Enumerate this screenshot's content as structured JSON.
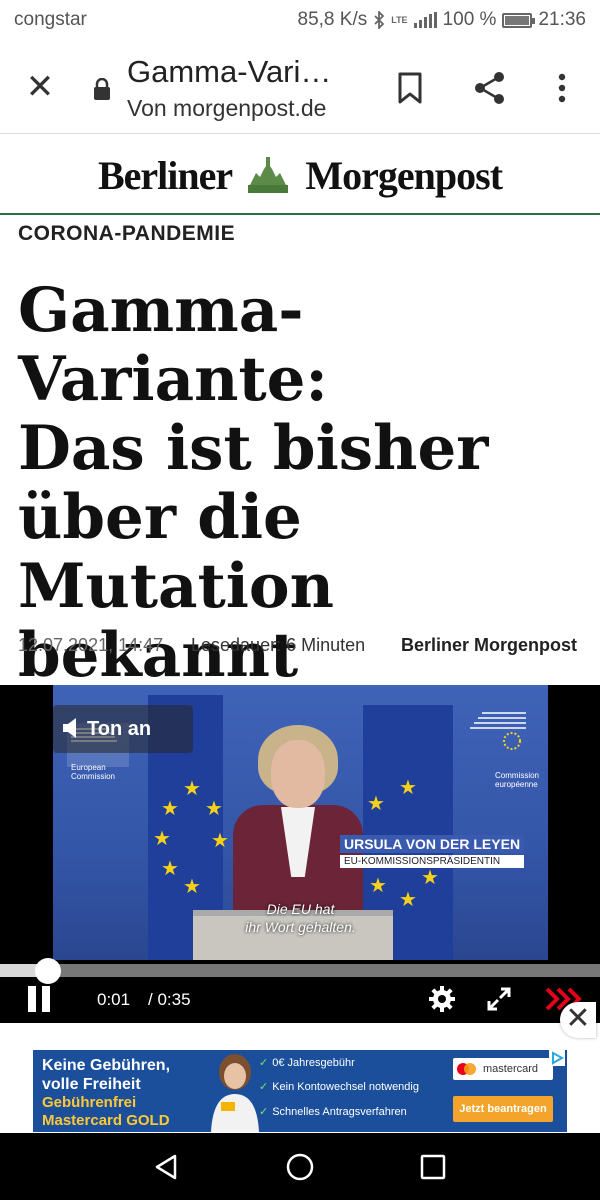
{
  "status_bar": {
    "carrier": "congstar",
    "speed": "85,8 K/s",
    "network": "LTE",
    "battery": "100 %",
    "time": "21:36"
  },
  "browser": {
    "title": "Gamma-Vari…",
    "source": "Von morgenpost.de",
    "icons": [
      "close-icon",
      "lock-icon",
      "bookmark-icon",
      "share-icon",
      "more-vert-icon"
    ]
  },
  "logo": {
    "left": "Berliner",
    "right": "Morgenpost"
  },
  "article": {
    "kicker": "CORONA-PANDEMIE",
    "headline_lines": [
      "Gamma-Variante:",
      "Das ist bisher",
      "über die",
      "Mutation",
      "bekannt"
    ],
    "date": "12.07.2021, 14:47",
    "reading_time": "Lesedauer: 6 Minuten",
    "source": "Berliner Morgenpost"
  },
  "video": {
    "sound_button": "Ton an",
    "left_logo_text": "European Commission",
    "right_logo_text": "Commission européenne",
    "name": "URSULA VON DER LEYEN",
    "role": "EU-KOMMISSIONSPRÄSIDENTIN",
    "subtitle_lines": [
      "Die EU hat",
      "ihr Wort gehalten."
    ],
    "current_time": "0:01",
    "duration": "/ 0:35",
    "progress_fraction": 0.03,
    "accent_color": "#e3001b"
  },
  "ad": {
    "headline_lines": [
      "Keine Gebühren,",
      "volle Freiheit"
    ],
    "sub_lines": [
      "Gebührenfrei",
      "Mastercard GOLD"
    ],
    "features": [
      "0€ Jahresgebühr",
      "Kein Kontowechsel notwendig",
      "Schnelles Antragsverfahren"
    ],
    "brand": "mastercard",
    "cta": "Jetzt beantragen"
  },
  "nav": {
    "icons": [
      "back-icon",
      "home-icon",
      "recents-icon"
    ]
  }
}
